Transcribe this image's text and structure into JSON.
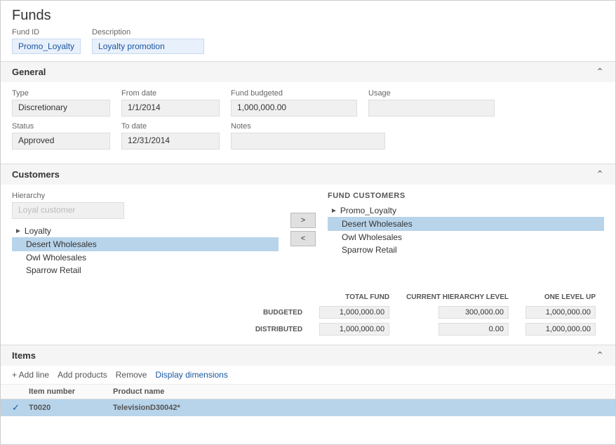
{
  "page": {
    "title": "Funds"
  },
  "fund_id": {
    "label": "Fund ID",
    "value": "Promo_Loyalty"
  },
  "description": {
    "label": "Description",
    "value": "Loyalty promotion"
  },
  "general": {
    "section_title": "General",
    "type_label": "Type",
    "type_value": "Discretionary",
    "from_date_label": "From date",
    "from_date_value": "1/1/2014",
    "fund_budgeted_label": "Fund budgeted",
    "fund_budgeted_value": "1,000,000.00",
    "usage_label": "Usage",
    "usage_value": "",
    "status_label": "Status",
    "status_value": "Approved",
    "to_date_label": "To date",
    "to_date_value": "12/31/2014",
    "notes_label": "Notes",
    "notes_value": ""
  },
  "customers": {
    "section_title": "Customers",
    "hierarchy_label": "Hierarchy",
    "hierarchy_placeholder": "Loyal customer",
    "btn_add": ">",
    "btn_remove": "<",
    "left_tree": {
      "group_arrow": "◄",
      "group_name": "Loyalty",
      "children": [
        {
          "name": "Desert Wholesales",
          "selected": true
        },
        {
          "name": "Owl Wholesales",
          "selected": false
        },
        {
          "name": "Sparrow Retail",
          "selected": false
        }
      ]
    },
    "fund_customers_label": "FUND CUSTOMERS",
    "right_tree": {
      "parent": "Promo_Loyalty",
      "children": [
        {
          "name": "Desert Wholesales",
          "selected": true
        },
        {
          "name": "Owl Wholesales",
          "selected": false
        },
        {
          "name": "Sparrow Retail",
          "selected": false
        }
      ]
    }
  },
  "summary": {
    "col_total_fund": "TOTAL FUND",
    "col_hierarchy": "CURRENT HIERARCHY LEVEL",
    "col_one_level": "ONE LEVEL UP",
    "row_budgeted": "BUDGETED",
    "row_distributed": "DISTRIBUTED",
    "budgeted_total": "1,000,000.00",
    "budgeted_hierarchy": "300,000.00",
    "budgeted_one_level": "1,000,000.00",
    "distributed_total": "1,000,000.00",
    "distributed_hierarchy": "0.00",
    "distributed_one_level": "1,000,000.00"
  },
  "items": {
    "section_title": "Items",
    "toolbar": {
      "add_line": "+ Add line",
      "add_products": "Add products",
      "remove": "Remove",
      "display_dimensions": "Display dimensions"
    },
    "grid": {
      "col_check": "",
      "col_item_number": "Item number",
      "col_product_name": "Product name",
      "rows": [
        {
          "check": true,
          "item_number": "T0020",
          "product_name": "TelevisionD30042*",
          "selected": true
        }
      ]
    }
  }
}
